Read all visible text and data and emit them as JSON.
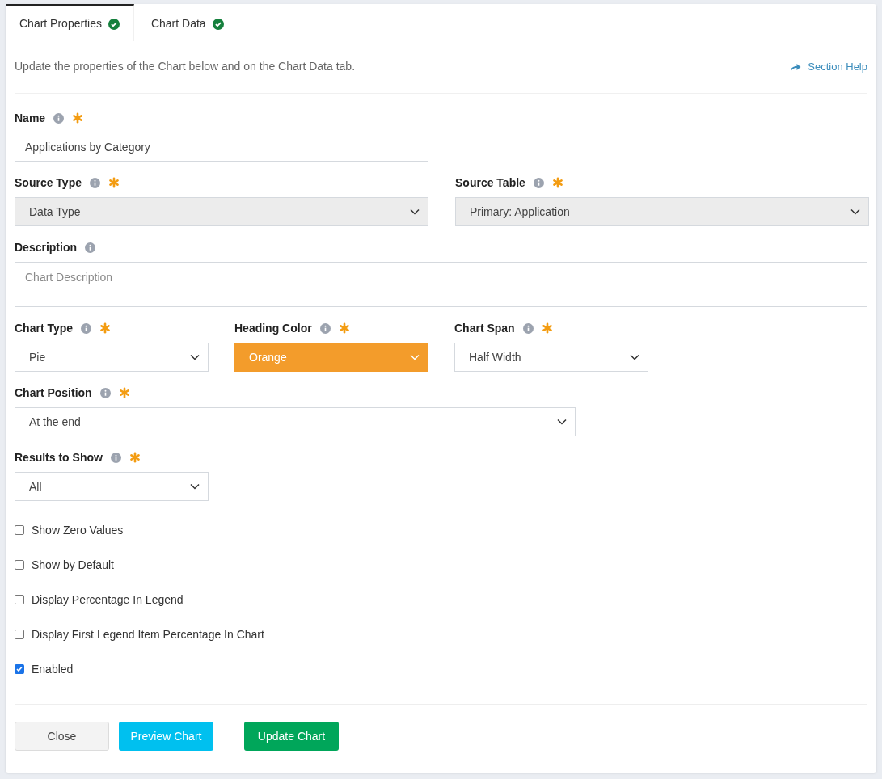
{
  "tabs": [
    {
      "label": "Chart Properties",
      "selected": true,
      "complete": true
    },
    {
      "label": "Chart Data",
      "selected": false,
      "complete": true
    }
  ],
  "intro": "Update the properties of the Chart below and on the Chart Data tab.",
  "help_link": "Section Help",
  "rows": [
    [
      {
        "label": "Name",
        "required": true,
        "kind": "text",
        "value": "Applications by Category",
        "readonly": false
      }
    ],
    [
      {
        "label": "Source Type",
        "required": true,
        "kind": "select",
        "value": "Data Type",
        "readonly": true
      },
      {
        "label": "Source Table",
        "required": true,
        "kind": "select",
        "value": "Primary: Application",
        "readonly": true
      }
    ],
    [
      {
        "label": "Description",
        "required": false,
        "kind": "textarea",
        "placeholder": "Chart Description",
        "readonly": false
      }
    ],
    [
      {
        "label": "Chart Type",
        "required": true,
        "kind": "select",
        "value": "Pie",
        "readonly": false
      },
      {
        "label": "Heading Color",
        "required": true,
        "kind": "select",
        "value": "Orange",
        "readonly": false,
        "color": "#f39c2b"
      },
      {
        "label": "Chart Span",
        "required": true,
        "kind": "select",
        "value": "Half Width",
        "readonly": false
      }
    ],
    [
      {
        "label": "Chart Position",
        "required": true,
        "kind": "select",
        "value": "At the end",
        "readonly": false
      }
    ],
    [
      {
        "label": "Results to Show",
        "required": true,
        "kind": "select",
        "value": "All",
        "readonly": false
      }
    ]
  ],
  "checkboxes": [
    {
      "label": "Show Zero Values",
      "checked": false
    },
    {
      "label": "Show by Default",
      "checked": false
    },
    {
      "label": "Display Percentage In Legend",
      "checked": false
    },
    {
      "label": "Display First Legend Item Percentage In Chart",
      "checked": false
    },
    {
      "label": "Enabled",
      "checked": true
    }
  ],
  "buttons": [
    {
      "label": "Close",
      "kind": "default"
    },
    {
      "label": "Preview Chart",
      "kind": "info"
    },
    {
      "label": "Update Chart",
      "kind": "primary"
    }
  ]
}
